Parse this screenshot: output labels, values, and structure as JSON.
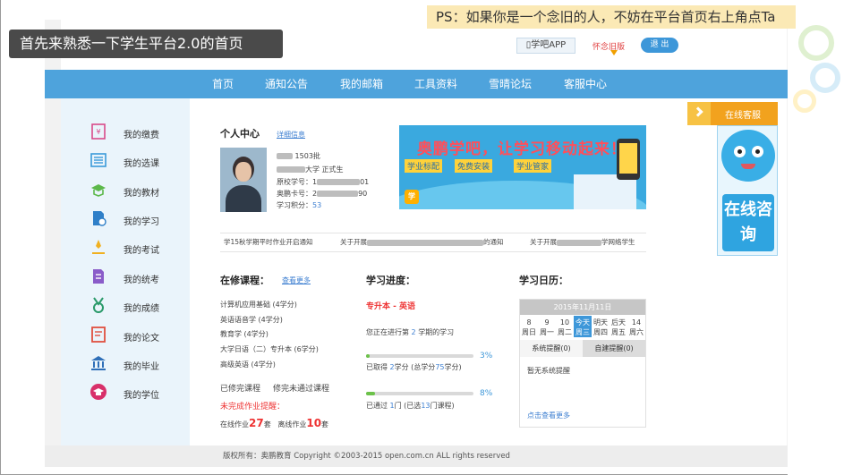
{
  "overlay": {
    "ps_banner": "PS：如果你是一个念旧的人，不妨在平台首页右上角点Ta",
    "caption": "首先来熟悉一下学生平台2.0的首页"
  },
  "topbar": {
    "app_button": "学吧APP",
    "old_version": "怀念旧版",
    "logout": "退 出"
  },
  "nav": {
    "items": [
      "首页",
      "通知公告",
      "我的邮箱",
      "工具资料",
      "雪晴论坛",
      "客服中心"
    ]
  },
  "sidebar": {
    "items": [
      {
        "label": "我的缴费",
        "icon": "payment-icon"
      },
      {
        "label": "我的选课",
        "icon": "course-select-icon"
      },
      {
        "label": "我的教材",
        "icon": "textbook-icon"
      },
      {
        "label": "我的学习",
        "icon": "study-icon"
      },
      {
        "label": "我的考试",
        "icon": "exam-icon"
      },
      {
        "label": "我的统考",
        "icon": "unified-exam-icon"
      },
      {
        "label": "我的成绩",
        "icon": "medal-icon"
      },
      {
        "label": "我的论文",
        "icon": "paper-icon"
      },
      {
        "label": "我的毕业",
        "icon": "graduation-building-icon"
      },
      {
        "label": "我的学位",
        "icon": "degree-cap-icon"
      }
    ]
  },
  "profile": {
    "title": "个人中心",
    "detail_link": "详细信息",
    "line1": "1503批",
    "line2": "大学 正式生",
    "line3_label": "原校学号：1",
    "line3_tail": "01",
    "line4_label": "奥鹏卡号：2",
    "line4_tail": "90",
    "line5_label": "学习积分：",
    "line5_value": "53"
  },
  "banner": {
    "headline": "奥鹏学吧，让学习移动起来！",
    "tag1": "学业标配",
    "tag2": "免费安装",
    "tag3": "学业管家"
  },
  "notices": {
    "items": [
      "学15秋学期平时作业开启通知",
      "关于开展",
      "的通知",
      "关于开展",
      "学网络学生"
    ]
  },
  "courses": {
    "title": "在修课程：",
    "more": "查看更多",
    "list": [
      "计算机应用基础 (4学分)",
      "英语语音学 (4学分)",
      "教育学 (4学分)",
      "大学日语（二）专升本 (6学分)",
      "高级英语 (4学分)"
    ],
    "done_label": "已修完课程",
    "not_passed_label": "修完未通过课程",
    "unfinished_label": "未完成作业提醒：",
    "online_label": "在线作业",
    "online_count": "27",
    "offline_label": "离线作业",
    "offline_count": "10",
    "unit": "套"
  },
  "progress": {
    "title": "学习进度：",
    "program": "专升本 - 英语",
    "semester_pre": "您正在进行第",
    "semester_num": "2",
    "semester_post": "学期的学习",
    "credit_value": 3,
    "credit_pct": "3%",
    "credit_pre": "已取得",
    "credit_num": "2",
    "credit_mid": "学分 (总学分",
    "credit_total": "75",
    "credit_post": "学分)",
    "course_value": 8,
    "course_pct": "8%",
    "course_pre": "已通过",
    "course_num": "1",
    "course_mid": "门 (已选",
    "course_total": "13",
    "course_post": "门课程)"
  },
  "calendar": {
    "title": "学习日历：",
    "date": "2015年11月11日",
    "days": [
      {
        "top": "8",
        "bottom": "周日"
      },
      {
        "top": "9",
        "bottom": "周一"
      },
      {
        "top": "10",
        "bottom": "周二"
      },
      {
        "top": "今天",
        "bottom": "周三"
      },
      {
        "top": "明天",
        "bottom": "周四"
      },
      {
        "top": "后天",
        "bottom": "周五"
      },
      {
        "top": "14",
        "bottom": "周六"
      }
    ],
    "today_index": 3,
    "tab_system": "系统提醒(0)",
    "tab_custom": "自建提醒(0)",
    "empty": "暂无系统提醒",
    "more": "点击查看更多"
  },
  "service": {
    "online_service": "在线客服",
    "consult": "在线咨询"
  },
  "footer": {
    "text": "版权所有：奥鹏教育 Copyright ©2003-2015 open.com.cn ALL rights reserved"
  }
}
